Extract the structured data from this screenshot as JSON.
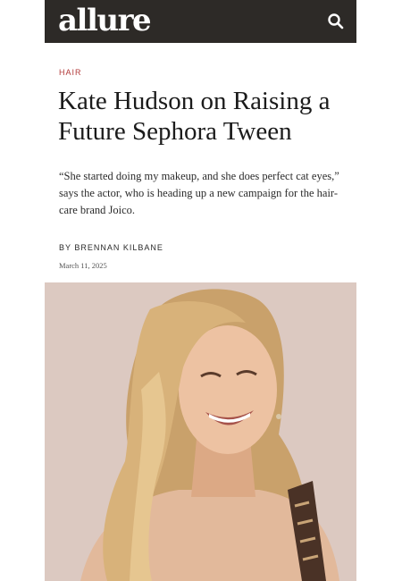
{
  "header": {
    "logo": "allure",
    "search_icon": "search-icon"
  },
  "article": {
    "category": "HAIR",
    "title": "Kate Hudson on Raising a Future Sephora Tween",
    "dek": "“She started doing my makeup, and she does perfect cat eyes,” says the actor, who is heading up a new campaign for the hair-care brand Joico.",
    "byline_prefix": "BY",
    "author": "BRENNAN KILBANE",
    "date": "March 11, 2025"
  },
  "colors": {
    "header_bg": "#2d2a27",
    "accent": "#b23a3a",
    "hero_bg": "#dcc9c1"
  }
}
